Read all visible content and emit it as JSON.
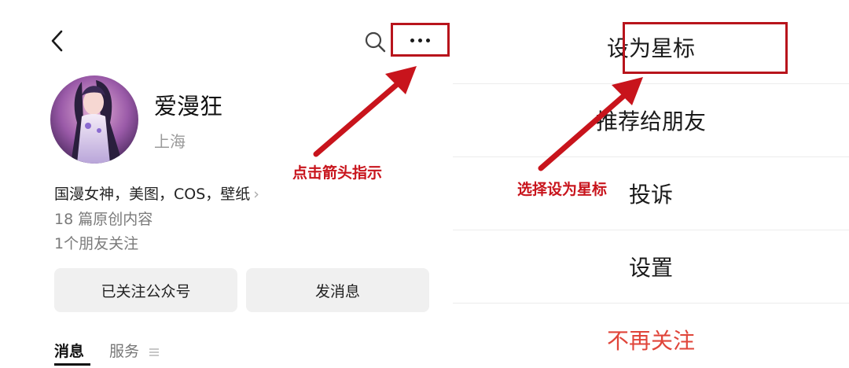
{
  "left": {
    "profile": {
      "name": "爱漫狂",
      "location": "上海",
      "description": "国漫女神，美图，COS，壁纸",
      "article_count": "18 篇原创内容",
      "friends_following": "1个朋友关注"
    },
    "buttons": {
      "followed": "已关注公众号",
      "message": "发消息"
    },
    "tabs": [
      {
        "label": "消息"
      },
      {
        "label": "服务"
      }
    ],
    "annotation": "点击箭头指示"
  },
  "right": {
    "menu": [
      {
        "label": "设为星标"
      },
      {
        "label": "推荐给朋友"
      },
      {
        "label": "投诉"
      },
      {
        "label": "设置"
      },
      {
        "label": "不再关注"
      }
    ],
    "annotation": "选择设为星标"
  },
  "colors": {
    "annotation_red": "#c8141c",
    "danger_red": "#e0453a",
    "button_bg": "#f0f0f0",
    "secondary_text": "#9a9a9a"
  },
  "icons": {
    "back": "chevron-left-icon",
    "search": "search-icon",
    "more": "more-dots-icon",
    "chevron_right": "chevron-right-icon",
    "tab_menu": "menu-lines-icon"
  }
}
